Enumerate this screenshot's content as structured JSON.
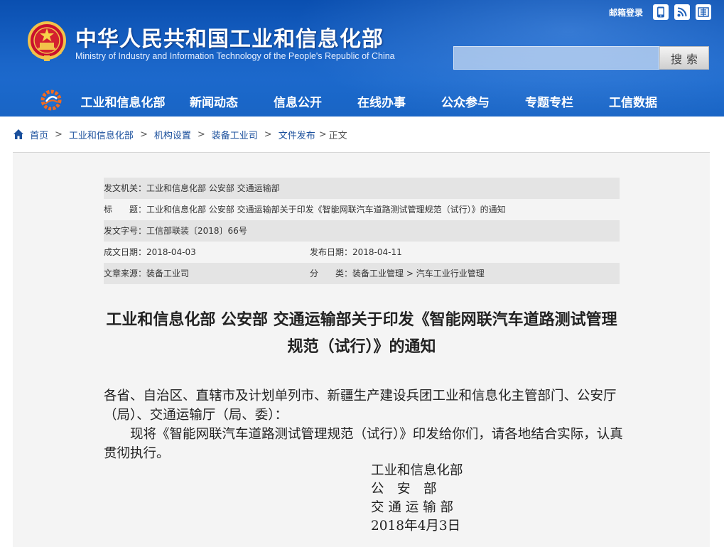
{
  "header": {
    "site_title": "中华人民共和国工业和信息化部",
    "site_subtitle": "Ministry of Industry and Information Technology of the People's Republic of China",
    "mail_login": "邮箱登录",
    "search_button": "搜索",
    "search_placeholder": "",
    "icons": [
      "mobile-icon",
      "rss-icon",
      "weibo-icon"
    ],
    "colors": {
      "header_blue": "#1b66c9",
      "nav_text": "#ffffff"
    }
  },
  "nav": {
    "items": [
      {
        "label": "工业和信息化部"
      },
      {
        "label": "新闻动态"
      },
      {
        "label": "信息公开"
      },
      {
        "label": "在线办事"
      },
      {
        "label": "公众参与"
      },
      {
        "label": "专题专栏"
      },
      {
        "label": "工信数据"
      }
    ]
  },
  "breadcrumb": {
    "items": [
      "首页",
      "工业和信息化部",
      "机构设置",
      "装备工业司",
      "文件发布"
    ],
    "current": "正文",
    "separator": ">"
  },
  "meta": {
    "issuer_label": "发文机关：",
    "issuer": "工业和信息化部 公安部 交通运输部",
    "title_label": "标　　题：",
    "title": "工业和信息化部 公安部 交通运输部关于印发《智能网联汽车道路测试管理规范（试行）》的通知",
    "docno_label": "发文字号：",
    "docno": "工信部联装〔2018〕66号",
    "created_label": "成文日期：",
    "created": "2018-04-03",
    "published_label": "发布日期：",
    "published": "2018-04-11",
    "source_label": "文章来源：",
    "source": "装备工业司",
    "category_label": "分　　类：",
    "category": "装备工业管理 > 汽车工业行业管理"
  },
  "document": {
    "heading": "工业和信息化部 公安部 交通运输部关于印发《智能网联汽车道路测试管理规范（试行）》的通知",
    "salutation": "各省、自治区、直辖市及计划单列市、新疆生产建设兵团工业和信息化主管部门、公安厅（局）、交通运输厅（局、委）：",
    "paragraph": "现将《智能网联汽车道路测试管理规范（试行）》印发给你们，请各地结合实际，认真贯彻执行。",
    "signatories": [
      "工业和信息化部",
      "公　安　部",
      "交 通 运 输 部"
    ],
    "date": "2018年4月3日"
  }
}
